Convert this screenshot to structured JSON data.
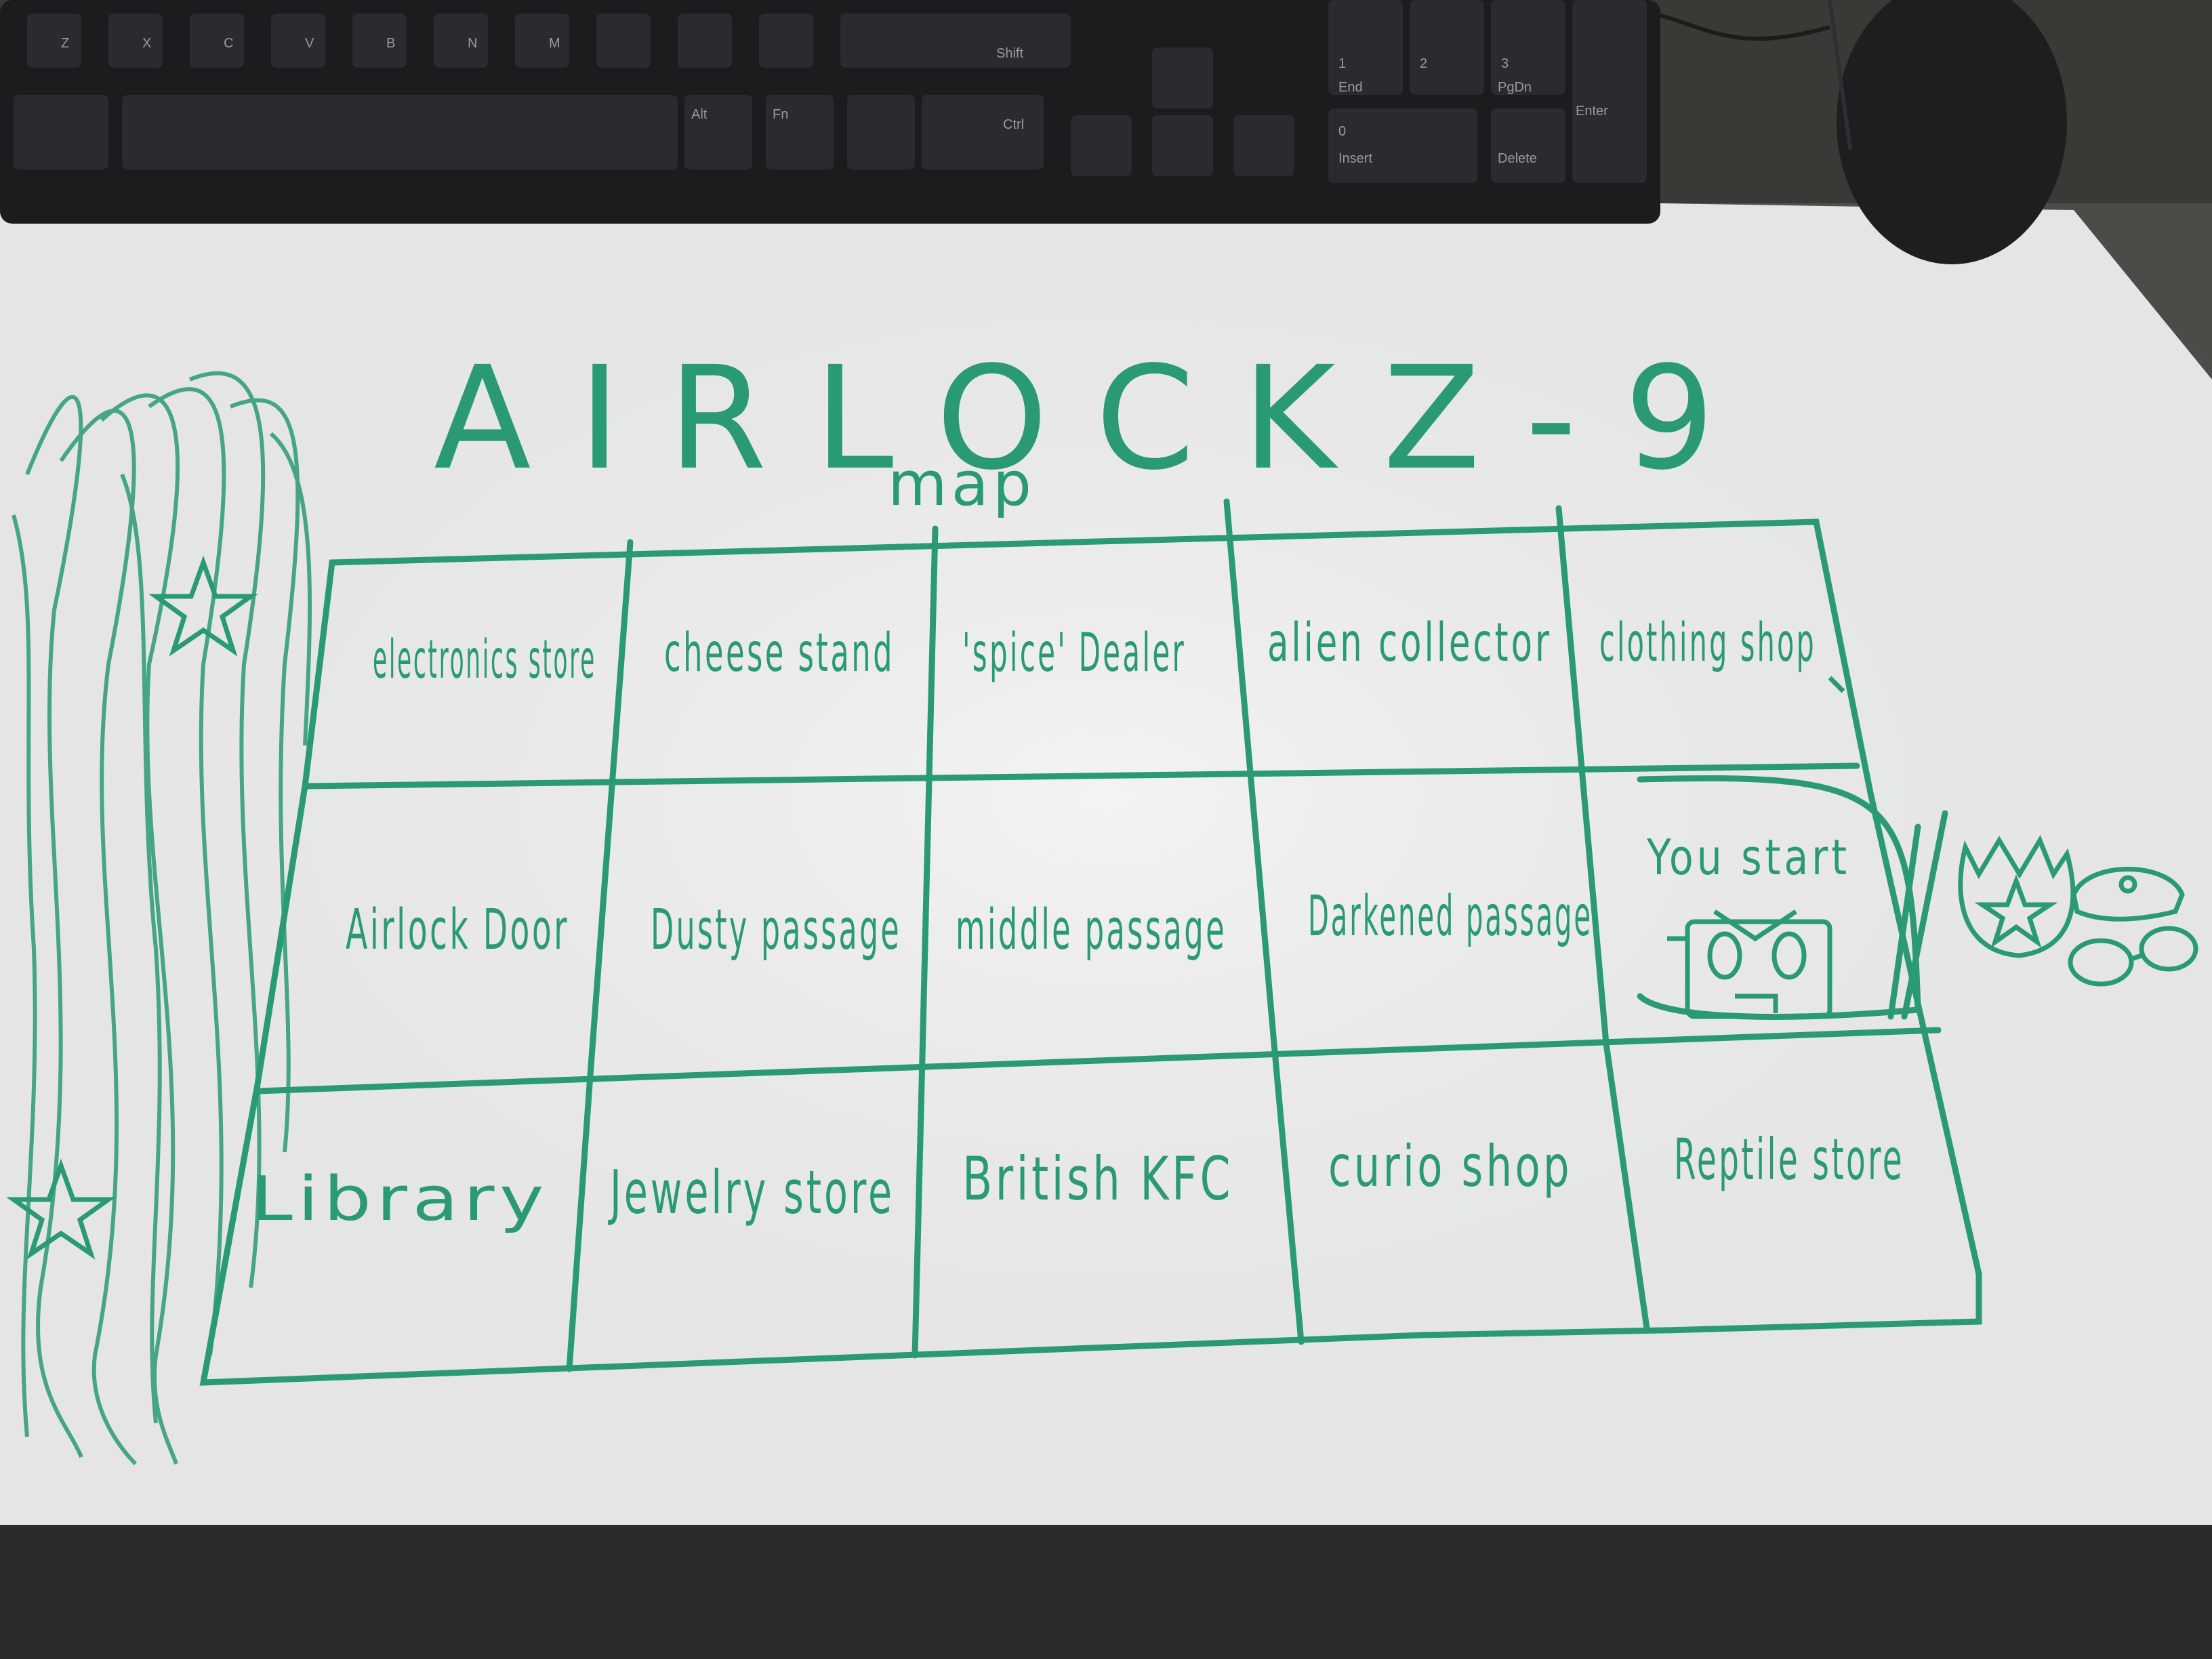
{
  "title": "AIRLOCKZ-9",
  "subtitle": "map",
  "grid": [
    [
      "electronics store",
      "cheese stand",
      "'spice' Dealer",
      "alien collector",
      "clothing shop"
    ],
    [
      "Airlock Door",
      "Dusty passage",
      "middle passage",
      "Darkened passage",
      "You start"
    ],
    [
      "Library",
      "Jewelry store",
      "British KFC",
      "curio shop",
      "Reptile store"
    ]
  ],
  "keyboard_legends": [
    "Z",
    "X",
    "C",
    "V",
    "B",
    "N",
    "M",
    "Alt",
    "Fn",
    "Ctrl",
    "Shift",
    "Enter",
    "End",
    "PgDn",
    "Insert",
    "Delete",
    "0",
    "1",
    "2",
    "3"
  ],
  "colors": {
    "marker": "#2a9a76",
    "whiteboard": "#ecedea",
    "keyboard": "#1b1c1e",
    "floor": "#3a3936"
  },
  "icons": [
    "grass-scribble-icon",
    "star-icon",
    "robot-icon",
    "crown-badge-icon",
    "police-cap-icon",
    "handcuffs-icon"
  ]
}
